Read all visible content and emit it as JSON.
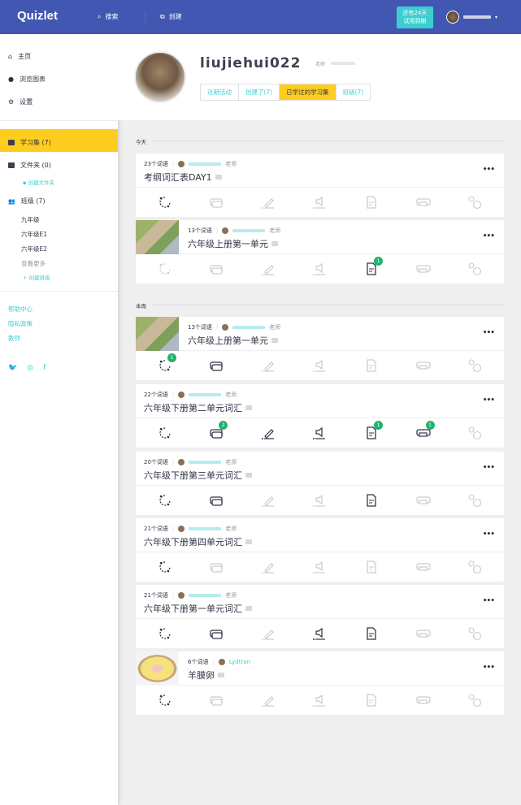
{
  "header": {
    "logo": "Quizlet",
    "search": "搜索",
    "create": "创建",
    "trial": "还有24天试用到期",
    "trial_l1": "还有24天",
    "trial_l2": "试用到期"
  },
  "sidebar": {
    "home": "主页",
    "browse": "浏览图表",
    "settings": "设置",
    "sets": "学习集 (7)",
    "folders": "文件夹 (0)",
    "create_folder": "创建文件夹",
    "classes": "班级 (7)",
    "class_list": [
      "九年级",
      "六年级E1",
      "六年级E2"
    ],
    "see_more": "查看更多",
    "create_class": "创建班级",
    "help": "帮助中心",
    "privacy": "隐私政策",
    "teachers": "教师"
  },
  "profile": {
    "username": "liujiehui022",
    "role": "老师",
    "tabs": [
      "近期活动",
      "创建了(7)",
      "已学过的学习集",
      "班级(7)"
    ],
    "active_tab": 2
  },
  "colors": {
    "header": "#4257b2",
    "accent": "#3ccfcf",
    "active": "#ffcd1f",
    "badge": "#23b26d"
  },
  "sections": [
    {
      "label": "今天"
    },
    {
      "label": "本周"
    }
  ],
  "sets": [
    {
      "count": "23个词语",
      "title": "考纲词汇表DAY1",
      "teacher": "老师",
      "thumb": null,
      "active": [
        0
      ],
      "badges": {}
    },
    {
      "count": "13个词语",
      "title": "六年级上册第一单元",
      "teacher": "老师",
      "thumb": "map",
      "active": [
        4
      ],
      "badges": {
        "4": "1"
      }
    },
    {
      "count": "13个词语",
      "title": "六年级上册第一单元",
      "teacher": "老师",
      "thumb": "map",
      "active": [
        0,
        1
      ],
      "badges": {
        "0": "1"
      }
    },
    {
      "count": "22个词语",
      "title": "六年级下册第二单元词汇",
      "teacher": "老师",
      "thumb": null,
      "active": [
        0,
        1,
        2,
        3,
        4,
        5
      ],
      "badges": {
        "1": "2",
        "4": "1",
        "5": "1"
      }
    },
    {
      "count": "20个词语",
      "title": "六年级下册第三单元词汇",
      "teacher": "老师",
      "thumb": null,
      "active": [
        0,
        1,
        4
      ],
      "badges": {}
    },
    {
      "count": "21个词语",
      "title": "六年级下册第四单元词汇",
      "teacher": "老师",
      "thumb": null,
      "active": [
        0
      ],
      "badges": {}
    },
    {
      "count": "21个词语",
      "title": "六年级下册第一单元词汇",
      "teacher": "老师",
      "thumb": null,
      "active": [
        0,
        1,
        3,
        4
      ],
      "badges": {}
    },
    {
      "count": "6个词语",
      "title": "羊膜卵",
      "author": "Lydtran",
      "thumb": "egg",
      "active": [
        0
      ],
      "badges": {}
    }
  ],
  "modes": [
    "learn-icon",
    "flashcards-icon",
    "write-icon",
    "spell-icon",
    "test-icon",
    "match-icon",
    "gravity-icon"
  ]
}
